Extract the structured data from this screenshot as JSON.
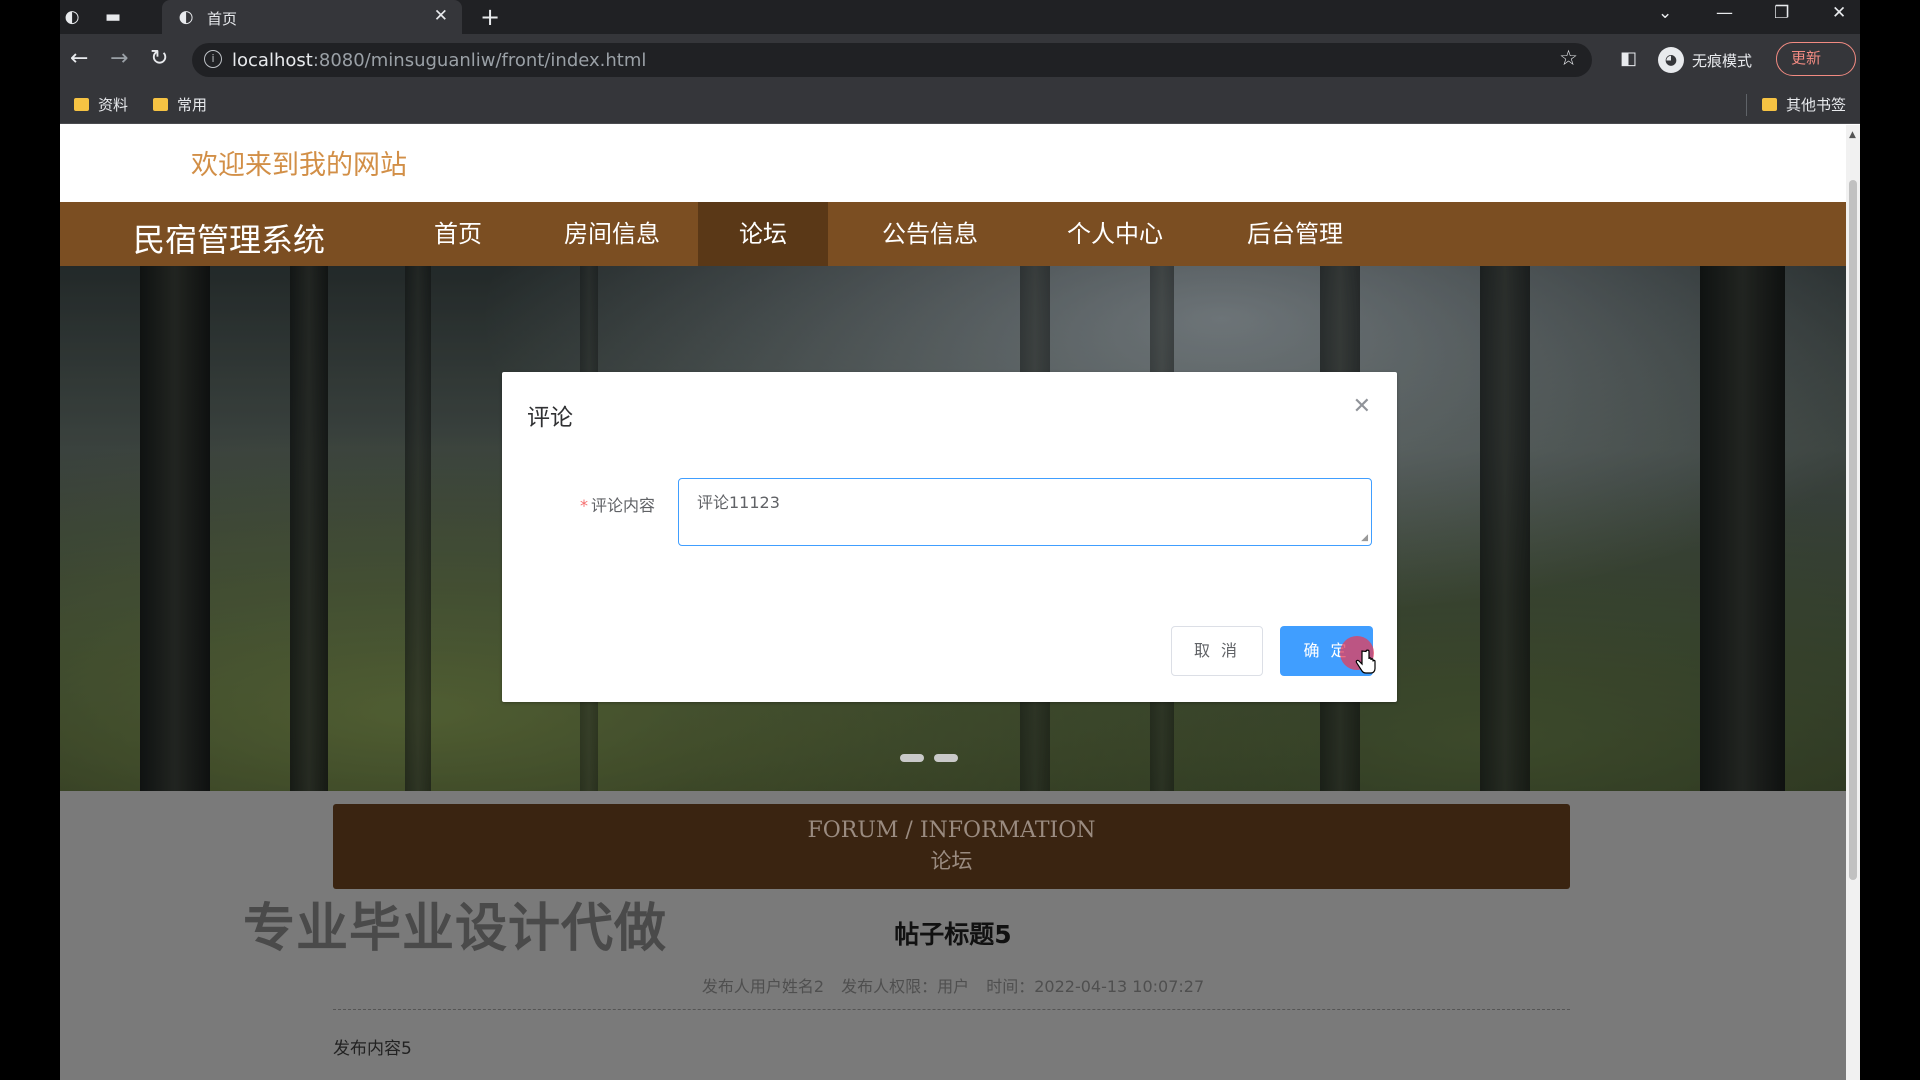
{
  "browser": {
    "tab_title": "首页",
    "url_host": "localhost",
    "url_rest": ":8080/minsuguanliw/front/index.html",
    "incognito_label": "无痕模式",
    "update_label": "更新",
    "bookmarks": [
      "资料",
      "常用"
    ],
    "other_bookmarks": "其他书签"
  },
  "site": {
    "welcome": "欢迎来到我的网站",
    "brand": "民宿管理系统",
    "nav": [
      "首页",
      "房间信息",
      "论坛",
      "公告信息",
      "个人中心",
      "后台管理"
    ],
    "active_nav": "论坛"
  },
  "section": {
    "title_en": "FORUM / INFORMATION",
    "title_cn": "论坛"
  },
  "watermark": "专业毕业设计代做",
  "post": {
    "title": "帖子标题5",
    "author": "发布人用户姓名2",
    "role": "发布人权限：用户",
    "time": "时间：2022-04-13 10:07:27",
    "content_partial": "发布内容5"
  },
  "dialog": {
    "title": "评论",
    "field_label": "评论内容",
    "field_value": "评论11123",
    "cancel_label": "取 消",
    "confirm_label": "确 定"
  },
  "colors": {
    "accent": "#409eff",
    "nav_bg": "#7b4e22",
    "nav_active": "#5a3817",
    "welcome": "#d28f47"
  }
}
